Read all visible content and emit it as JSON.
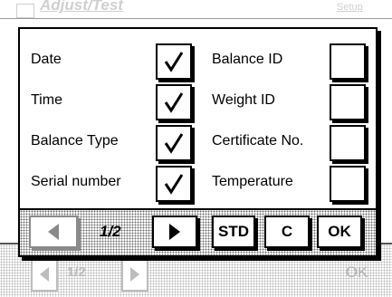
{
  "background": {
    "title": "Adjust/Test",
    "setup_label": "Setup",
    "page_indicator": "1/2",
    "ok_label": "OK"
  },
  "dialog": {
    "left_column": [
      {
        "label": "Date",
        "checked": true
      },
      {
        "label": "Time",
        "checked": true
      },
      {
        "label": "Balance Type",
        "checked": true
      },
      {
        "label": "Serial number",
        "checked": true
      }
    ],
    "right_column": [
      {
        "label": "Balance ID",
        "checked": false
      },
      {
        "label": "Weight ID",
        "checked": false
      },
      {
        "label": "Certificate No.",
        "checked": false
      },
      {
        "label": "Temperature",
        "checked": false
      }
    ],
    "toolbar": {
      "page_indicator": "1/2",
      "std_label": "STD",
      "c_label": "C",
      "ok_label": "OK"
    }
  }
}
